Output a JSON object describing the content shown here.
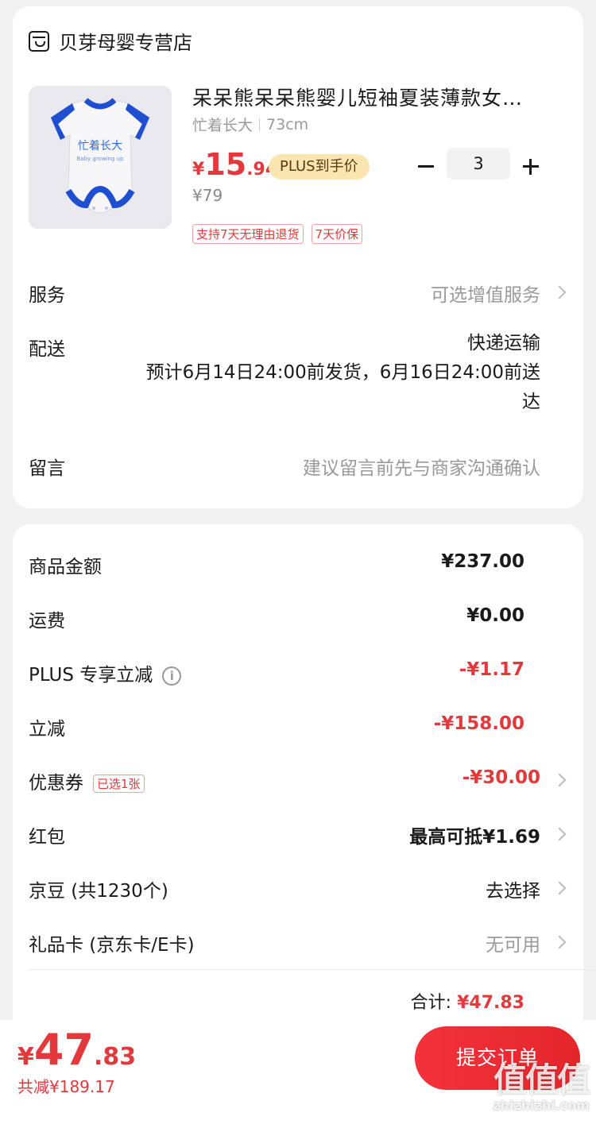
{
  "shop": {
    "name": "贝芽母婴专营店",
    "icon": "shop-icon"
  },
  "product": {
    "title": "呆呆熊呆呆熊婴儿短袖夏装薄款女…",
    "spec_style": "忙着长大",
    "spec_size": "73cm",
    "image_text_cn": "忙着长大",
    "image_text_en": "Baby growing up",
    "price_currency": "¥",
    "price_int": "15",
    "price_dec": ".94",
    "plus_tag": "PLUS到手价",
    "quantity": "3",
    "original_price": "¥79",
    "tags": [
      "支持7天无理由退货",
      "7天价保"
    ]
  },
  "service": {
    "label": "服务",
    "value": "可选增值服务"
  },
  "delivery": {
    "label": "配送",
    "method": "快递运输",
    "estimate_line1": "预计6月14日24:00前发货，6月16日24:00前送",
    "estimate_line2": "达"
  },
  "message": {
    "label": "留言",
    "placeholder": "建议留言前先与商家沟通确认"
  },
  "summary": {
    "goods_label": "商品金额",
    "goods_value": "¥237.00",
    "shipping_label": "运费",
    "shipping_value": "¥0.00",
    "plus_label": "PLUS 专享立减",
    "plus_value": "-¥1.17",
    "discount_label": "立减",
    "discount_value": "-¥158.00",
    "coupon_label": "优惠券",
    "coupon_tag": "已选1张",
    "coupon_value": "-¥30.00",
    "redpacket_label": "红包",
    "redpacket_value": "最高可抵¥1.69",
    "jingdou_label": "京豆 (共1230个)",
    "jingdou_value": "去选择",
    "giftcard_label": "礼品卡 (京东卡/E卡)",
    "giftcard_value": "无可用",
    "total_label": "合计:",
    "total_value": "¥47.83"
  },
  "footer": {
    "pay_currency": "¥",
    "pay_int": "47",
    "pay_dec": ".83",
    "saved": "共减¥189.17",
    "submit_label": "提交订单",
    "watermark_logo": "值值值",
    "watermark_domain": "zhizhizhi.com"
  },
  "colors": {
    "accent": "#e4393c",
    "plus_tag_bg": "#fbe6b2",
    "page_bg": "#f2f2f2"
  }
}
